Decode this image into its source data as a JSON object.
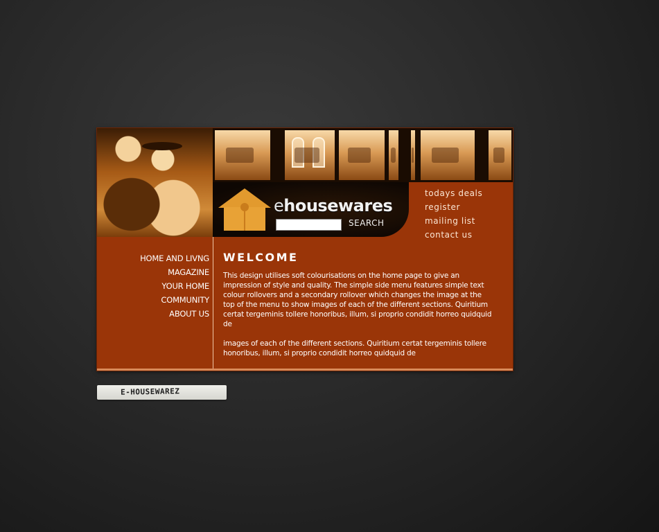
{
  "header": {
    "brand_prefix": "e",
    "brand_name": "housewares",
    "search_label": "SEARCH",
    "search_value": ""
  },
  "top_nav": [
    "todays deals",
    "register",
    "mailing list",
    "contact us"
  ],
  "side_nav": [
    "HOME AND LIVNG MAGAZINE",
    "YOUR HOME",
    "COMMUNITY",
    "ABOUT US"
  ],
  "main": {
    "title": "WELCOME",
    "paragraphs": [
      "This design utilises soft colourisations on the home page to give an impression of style and quality.  The simple side menu features simple text colour rollovers and a secondary rollover which changes the image at the top of the menu to show images of each of the different  sections. Quiritium certat tergeminis tollere honoribus, illum, si proprio condidit horreo quidquid de",
      "images of each of the different  sections. Quiritium certat tergeminis tollere honoribus, illum, si proprio condidit horreo quidquid de"
    ]
  },
  "footer_tag": "E-HOUSEWAREZ",
  "colors": {
    "panel": "#9a3508",
    "accent": "#e29a2e",
    "background": "#262626"
  }
}
